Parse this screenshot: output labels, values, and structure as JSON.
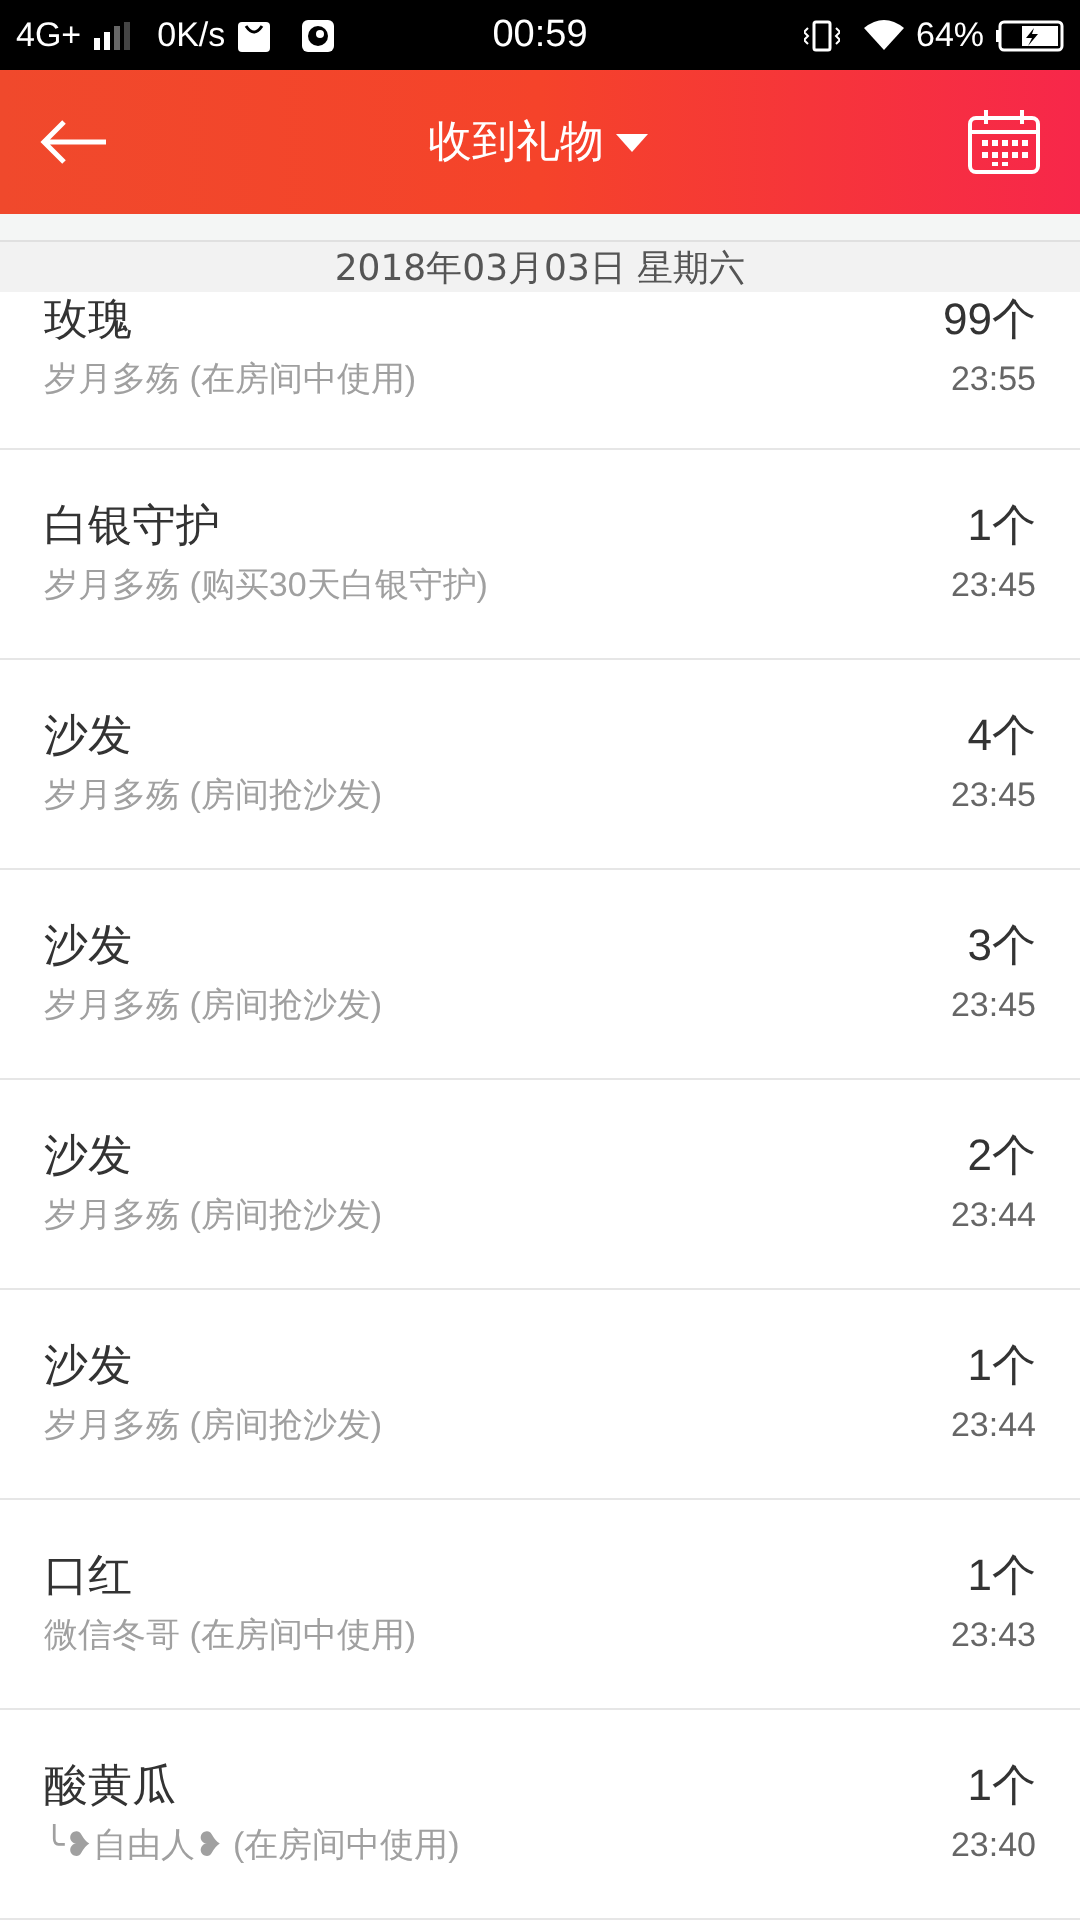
{
  "status_bar": {
    "network": "4G+",
    "speed": "0K/s",
    "time": "00:59",
    "battery": "64%"
  },
  "header": {
    "title": "收到礼物"
  },
  "date_header": "2018年03月03日 星期六",
  "rows": [
    {
      "name": "玫瑰",
      "subtitle": "岁月多殇 (在房间中使用)",
      "count": "99个",
      "time": "23:55"
    },
    {
      "name": "白银守护",
      "subtitle": "岁月多殇 (购买30天白银守护)",
      "count": "1个",
      "time": "23:45"
    },
    {
      "name": "沙发",
      "subtitle": "岁月多殇 (房间抢沙发)",
      "count": "4个",
      "time": "23:45"
    },
    {
      "name": "沙发",
      "subtitle": "岁月多殇 (房间抢沙发)",
      "count": "3个",
      "time": "23:45"
    },
    {
      "name": "沙发",
      "subtitle": "岁月多殇 (房间抢沙发)",
      "count": "2个",
      "time": "23:44"
    },
    {
      "name": "沙发",
      "subtitle": "岁月多殇 (房间抢沙发)",
      "count": "1个",
      "time": "23:44"
    },
    {
      "name": "口红",
      "subtitle": "微信冬哥 (在房间中使用)",
      "count": "1个",
      "time": "23:43"
    },
    {
      "name": "酸黄瓜",
      "subtitle": "╰❥自由人❥ (在房间中使用)",
      "count": "1个",
      "time": "23:40"
    }
  ]
}
